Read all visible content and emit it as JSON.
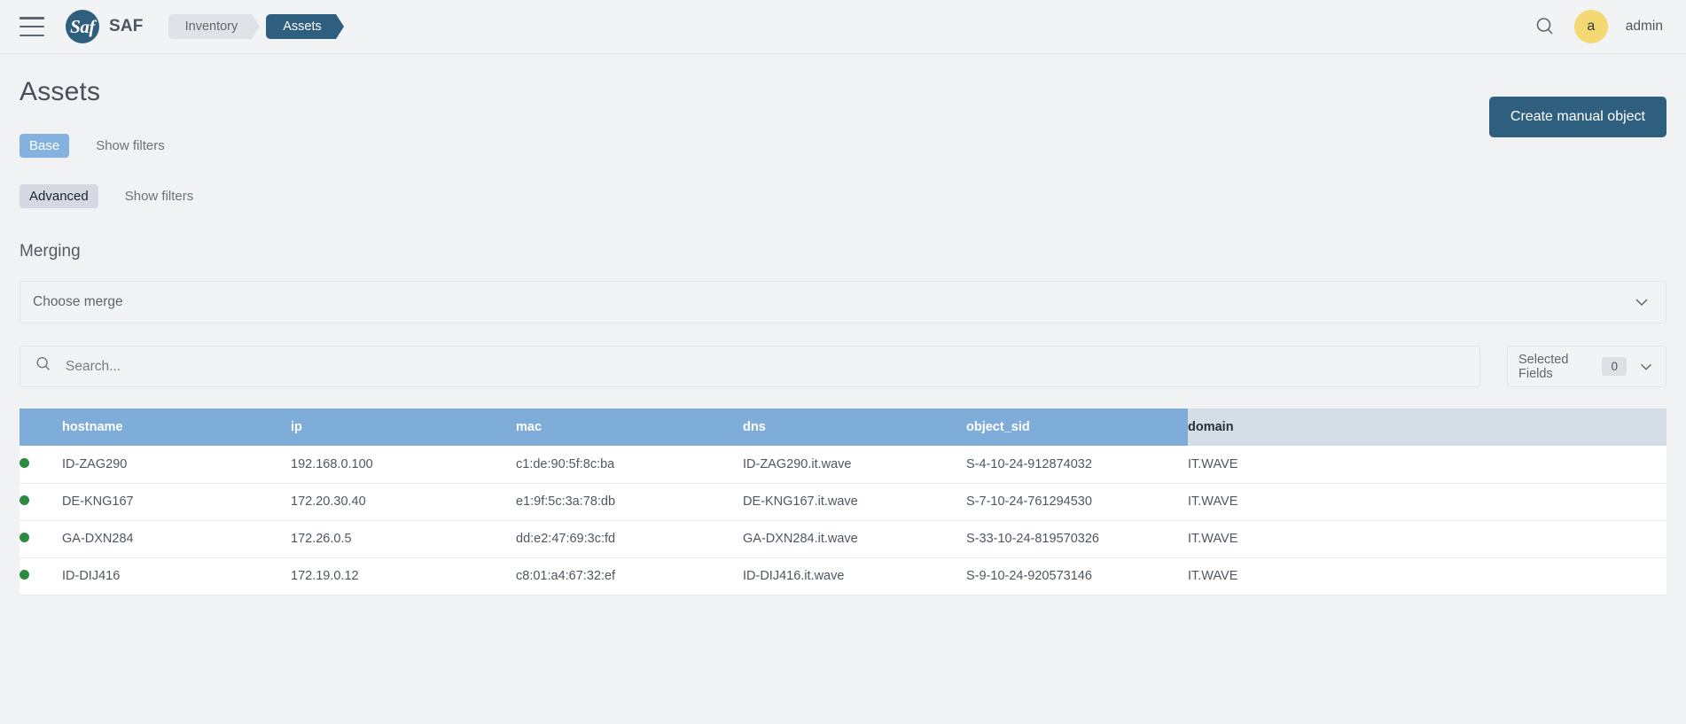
{
  "topbar": {
    "menu_icon": "hamburger-menu-icon",
    "logo_mark": "Saf",
    "brand": "SAF",
    "breadcrumbs": [
      {
        "label": "Inventory",
        "active": false
      },
      {
        "label": "Assets",
        "active": true
      }
    ],
    "search_icon": "search-icon",
    "avatar_initial": "a",
    "username": "admin"
  },
  "header": {
    "title": "Assets",
    "create_button": "Create manual object"
  },
  "filters": {
    "base": {
      "chip": "Base",
      "show_filters": "Show filters"
    },
    "advanced": {
      "chip": "Advanced",
      "show_filters": "Show filters"
    }
  },
  "merging": {
    "section_title": "Merging",
    "select_value": "Choose merge",
    "chevron_icon": "chevron-down-icon"
  },
  "toolbar": {
    "search_placeholder": "Search...",
    "search_value": "",
    "search_icon": "search-icon",
    "selected_fields_label": "Selected Fields",
    "selected_fields_count": "0",
    "chevron_icon": "chevron-down-icon"
  },
  "table": {
    "columns": [
      "hostname",
      "ip",
      "mac",
      "dns",
      "object_sid",
      "domain"
    ],
    "rows": [
      {
        "status": "online",
        "hostname": "ID-ZAG290",
        "ip": "192.168.0.100",
        "mac": "c1:de:90:5f:8c:ba",
        "dns": "ID-ZAG290.it.wave",
        "object_sid": "S-4-10-24-912874032",
        "domain": "IT.WAVE"
      },
      {
        "status": "online",
        "hostname": "DE-KNG167",
        "ip": "172.20.30.40",
        "mac": "e1:9f:5c:3a:78:db",
        "dns": "DE-KNG167.it.wave",
        "object_sid": "S-7-10-24-761294530",
        "domain": "IT.WAVE"
      },
      {
        "status": "online",
        "hostname": "GA-DXN284",
        "ip": "172.26.0.5",
        "mac": "dd:e2:47:69:3c:fd",
        "dns": "GA-DXN284.it.wave",
        "object_sid": "S-33-10-24-819570326",
        "domain": "IT.WAVE"
      },
      {
        "status": "online",
        "hostname": "ID-DIJ416",
        "ip": "172.19.0.12",
        "mac": "c8:01:a4:67:32:ef",
        "dns": "ID-DIJ416.it.wave",
        "object_sid": "S-9-10-24-920573146",
        "domain": "IT.WAVE"
      }
    ]
  },
  "colors": {
    "brand_dark": "#2f5f7e",
    "table_header": "#7fadda",
    "chip_base": "#84b1dd",
    "status_dot": "#2d8a42",
    "avatar": "#f3d873",
    "page_bg": "#f0f2f4"
  }
}
